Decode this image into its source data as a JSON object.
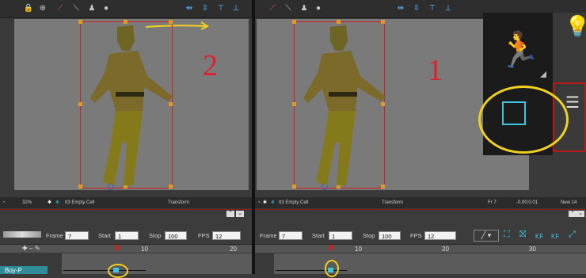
{
  "left": {
    "zoom": "32%",
    "cell": "tt3 Empty Cell",
    "mode": "Transform",
    "step_number": "2",
    "frame_label": "Frame",
    "frame": "7",
    "start_label": "Start",
    "start": "1",
    "stop_label": "Stop",
    "stop": "100",
    "fps_label": "FPS",
    "fps": "12",
    "ruler": [
      "10",
      "20"
    ],
    "layer": "Boy-P"
  },
  "right": {
    "cell": "tt3 Empty Cell",
    "mode": "Transform",
    "fr": "Fr 7",
    "coords": "-0.00;0.01",
    "new": "New 14",
    "step_number": "1",
    "frame_label": "Frame",
    "frame": "7",
    "start_label": "Start",
    "start": "1",
    "stop_label": "Stop",
    "stop": "100",
    "fps_label": "FPS",
    "fps": "12",
    "ruler": [
      "10",
      "20",
      "30"
    ],
    "kf1": "KF",
    "kf2": "KF"
  },
  "colors": {
    "accent_yellow": "#f0d020",
    "bbox_red": "#d02020",
    "handle_orange": "#e39a1e",
    "number_red": "#e02030",
    "tool_cyan": "#3ec6e0"
  }
}
